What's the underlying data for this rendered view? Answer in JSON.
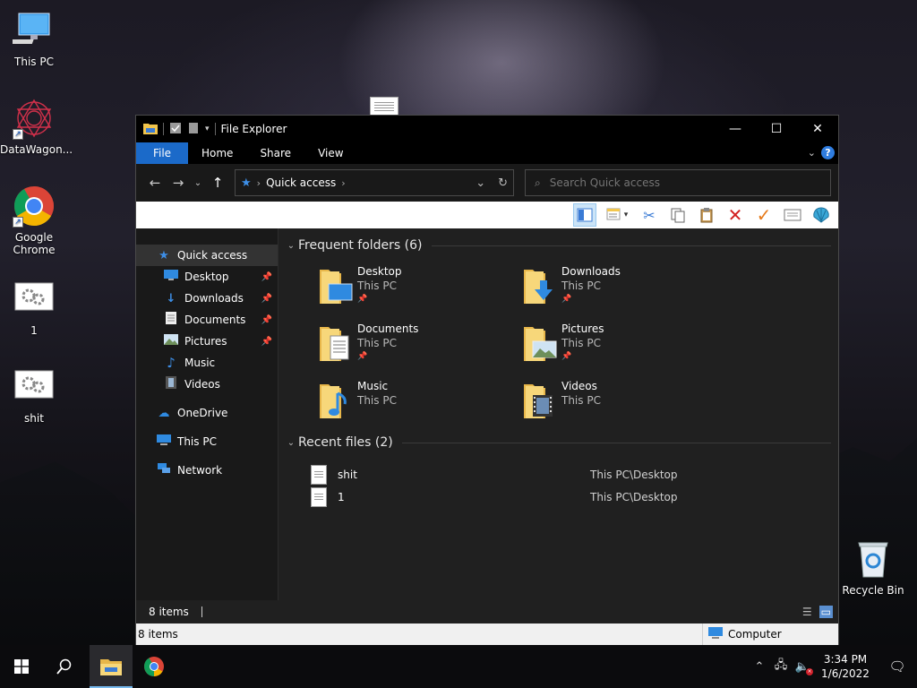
{
  "desktop": {
    "icons": [
      {
        "label": "This PC"
      },
      {
        "label": "DataWagon..."
      },
      {
        "label": "Google\nChrome"
      },
      {
        "label": "1"
      },
      {
        "label": "shit"
      },
      {
        "label": "Recycle Bin"
      }
    ]
  },
  "explorer": {
    "title": "File Explorer",
    "tabs": {
      "file": "File",
      "home": "Home",
      "share": "Share",
      "view": "View"
    },
    "address": {
      "location": "Quick access"
    },
    "search": {
      "placeholder": "Search Quick access"
    },
    "nav": {
      "quick_access": "Quick access",
      "desktop": "Desktop",
      "downloads": "Downloads",
      "documents": "Documents",
      "pictures": "Pictures",
      "music": "Music",
      "videos": "Videos",
      "onedrive": "OneDrive",
      "this_pc": "This PC",
      "network": "Network"
    },
    "frequent": {
      "header": "Frequent folders (6)",
      "folders": [
        {
          "name": "Desktop",
          "location": "This PC"
        },
        {
          "name": "Downloads",
          "location": "This PC"
        },
        {
          "name": "Documents",
          "location": "This PC"
        },
        {
          "name": "Pictures",
          "location": "This PC"
        },
        {
          "name": "Music",
          "location": "This PC"
        },
        {
          "name": "Videos",
          "location": "This PC"
        }
      ]
    },
    "recent": {
      "header": "Recent files (2)",
      "files": [
        {
          "name": "shit",
          "path": "This PC\\Desktop"
        },
        {
          "name": "1",
          "path": "This PC\\Desktop"
        }
      ]
    },
    "status": {
      "items": "8 items"
    },
    "footer": {
      "items": "8 items",
      "zone": "Computer"
    }
  },
  "taskbar": {
    "time": "3:34 PM",
    "date": "1/6/2022"
  }
}
